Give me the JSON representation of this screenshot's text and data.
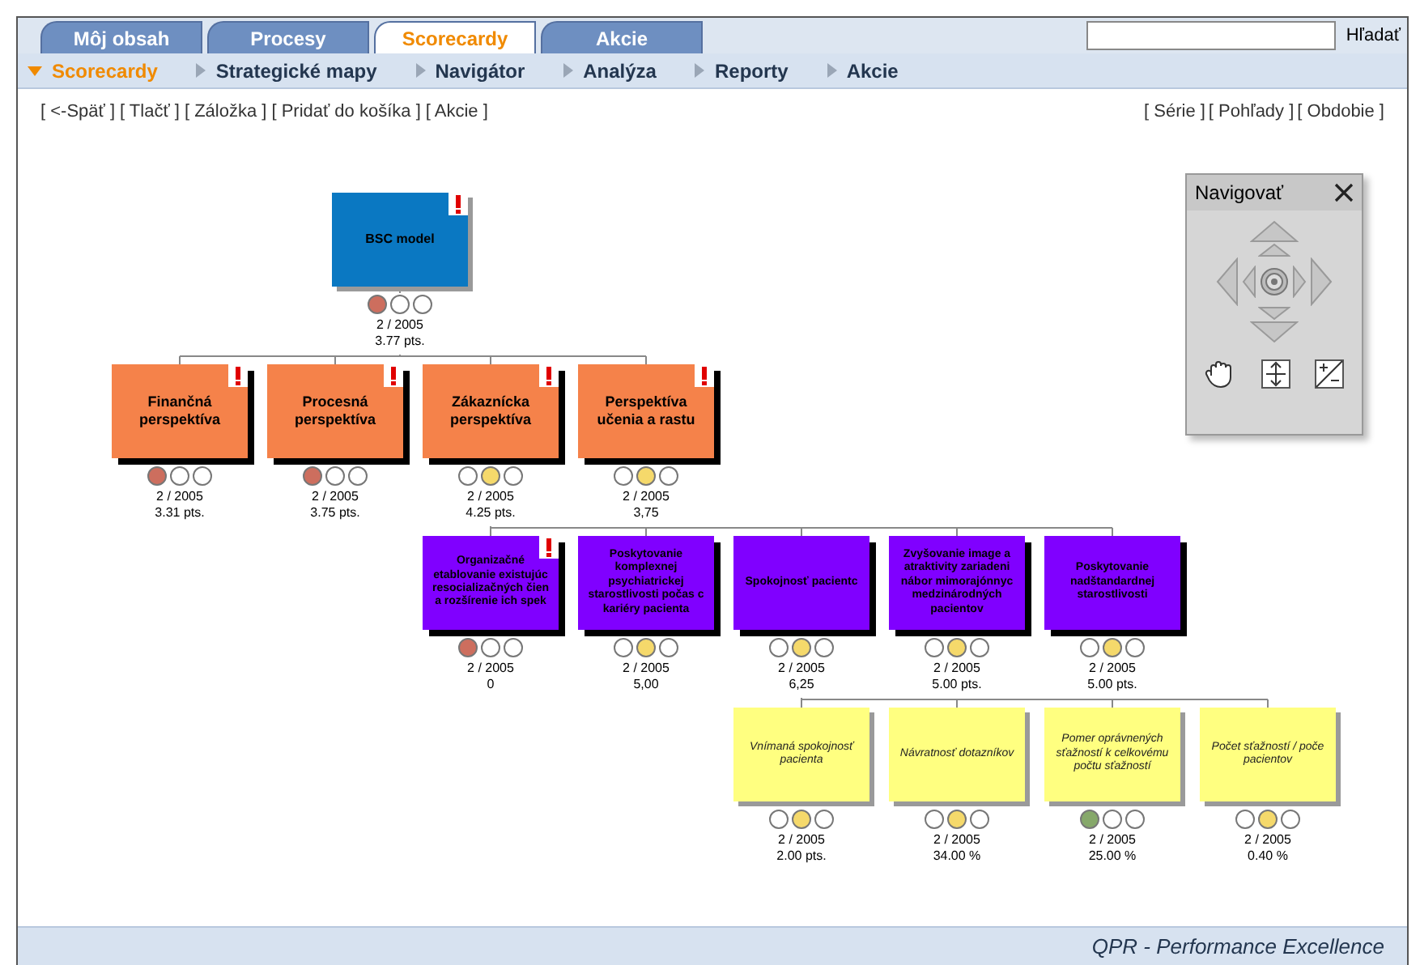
{
  "tabs": [
    {
      "label": "Môj obsah",
      "selected": false
    },
    {
      "label": "Procesy",
      "selected": false
    },
    {
      "label": "Scorecardy",
      "selected": true
    },
    {
      "label": "Akcie",
      "selected": false
    }
  ],
  "search": {
    "button": "Hľadať"
  },
  "submenu": [
    {
      "label": "Scorecardy",
      "selected": true
    },
    {
      "label": "Strategické mapy",
      "selected": false
    },
    {
      "label": "Navigátor",
      "selected": false
    },
    {
      "label": "Analýza",
      "selected": false
    },
    {
      "label": "Reporty",
      "selected": false
    },
    {
      "label": "Akcie",
      "selected": false
    }
  ],
  "actions_left": [
    "[ <-Späť ]",
    "[ Tlačť ]",
    "[ Záložka ]",
    "[ Pridať do košíka ]",
    "[ Akcie ]"
  ],
  "actions_right": [
    "[ Série ]",
    "[ Pohľady ]",
    "[ Obdobie ]"
  ],
  "tree": {
    "label": "BSC model",
    "kind": "root",
    "alert": true,
    "color": "#cd6e5e",
    "lights": [
      {
        "lit": true
      },
      {
        "lit": false
      },
      {
        "lit": false
      }
    ],
    "period": "2 / 2005",
    "value": "3.77 pts.",
    "children": [
      {
        "label": "Finančná perspektíva",
        "kind": "perspective",
        "alert": true,
        "color": "#cd6e5e",
        "lights": [
          {
            "lit": true
          },
          {
            "lit": false
          },
          {
            "lit": false
          }
        ],
        "period": "2 / 2005",
        "value": "3.31 pts."
      },
      {
        "label": "Procesná perspektíva",
        "kind": "perspective",
        "alert": true,
        "color": "#cd6e5e",
        "lights": [
          {
            "lit": true
          },
          {
            "lit": false
          },
          {
            "lit": false
          }
        ],
        "period": "2 / 2005",
        "value": "3.75 pts."
      },
      {
        "label": "Zákaznícka perspektíva",
        "kind": "perspective",
        "alert": true,
        "color": "#f5d96b",
        "lights": [
          {
            "lit": false
          },
          {
            "lit": true
          },
          {
            "lit": false
          }
        ],
        "period": "2 / 2005",
        "value": "4.25 pts.",
        "children": [
          {
            "label": "Organizačné etablovanie existujúc resocializačných čien a rozšírenie ich spek",
            "kind": "goal",
            "alert": true,
            "color": "#cd6e5e",
            "lights": [
              {
                "lit": true
              },
              {
                "lit": false
              },
              {
                "lit": false
              }
            ],
            "period": "2 / 2005",
            "value": "0"
          },
          {
            "label": "Poskytovanie komplexnej psychiatrickej starostlivosti počas c kariéry pacienta",
            "kind": "goal",
            "alert": false,
            "color": "#f5d96b",
            "lights": [
              {
                "lit": false
              },
              {
                "lit": true
              },
              {
                "lit": false
              }
            ],
            "period": "2 / 2005",
            "value": "5,00"
          },
          {
            "label": "Spokojnosť pacientc",
            "kind": "goal",
            "alert": false,
            "color": "#f5d96b",
            "lights": [
              {
                "lit": false
              },
              {
                "lit": true
              },
              {
                "lit": false
              }
            ],
            "period": "2 / 2005",
            "value": "6,25",
            "children": [
              {
                "label": "Vnímaná spokojnosť pacienta",
                "kind": "measure",
                "alert": false,
                "color": "#f5d96b",
                "lights": [
                  {
                    "lit": false
                  },
                  {
                    "lit": true
                  },
                  {
                    "lit": false
                  }
                ],
                "period": "2 / 2005",
                "value": "2.00 pts."
              },
              {
                "label": "Návratnosť dotazníkov",
                "kind": "measure",
                "alert": false,
                "color": "#f5d96b",
                "lights": [
                  {
                    "lit": false
                  },
                  {
                    "lit": true
                  },
                  {
                    "lit": false
                  }
                ],
                "period": "2 / 2005",
                "value": "34.00 %"
              },
              {
                "label": "Pomer oprávnených sťažností k celkovému počtu sťažností",
                "kind": "measure",
                "alert": false,
                "color": "#86a86a",
                "lights": [
                  {
                    "lit": true
                  },
                  {
                    "lit": false
                  },
                  {
                    "lit": false
                  }
                ],
                "period": "2 / 2005",
                "value": "25.00 %"
              },
              {
                "label": "Počet sťažností / poče pacientov",
                "kind": "measure",
                "alert": false,
                "color": "#f5d96b",
                "lights": [
                  {
                    "lit": false
                  },
                  {
                    "lit": true
                  },
                  {
                    "lit": false
                  }
                ],
                "period": "2 / 2005",
                "value": "0.40 %"
              }
            ]
          },
          {
            "label": "Zvyšovanie image a atraktivity zariadeni nábor mimorajónnyc medzinárodných pacientov",
            "kind": "goal",
            "alert": false,
            "color": "#f5d96b",
            "lights": [
              {
                "lit": false
              },
              {
                "lit": true
              },
              {
                "lit": false
              }
            ],
            "period": "2 / 2005",
            "value": "5.00 pts."
          },
          {
            "label": "Poskytovanie nadštandardnej starostlivosti",
            "kind": "goal",
            "alert": false,
            "color": "#f5d96b",
            "lights": [
              {
                "lit": false
              },
              {
                "lit": true
              },
              {
                "lit": false
              }
            ],
            "period": "2 / 2005",
            "value": "5.00 pts."
          }
        ]
      },
      {
        "label": "Perspektíva učenia a rastu",
        "kind": "perspective",
        "alert": true,
        "color": "#f5d96b",
        "lights": [
          {
            "lit": false
          },
          {
            "lit": true
          },
          {
            "lit": false
          }
        ],
        "period": "2 / 2005",
        "value": "3,75"
      }
    ]
  },
  "navigator": {
    "title": "Navigovať"
  },
  "footer": "QPR - Performance Excellence"
}
